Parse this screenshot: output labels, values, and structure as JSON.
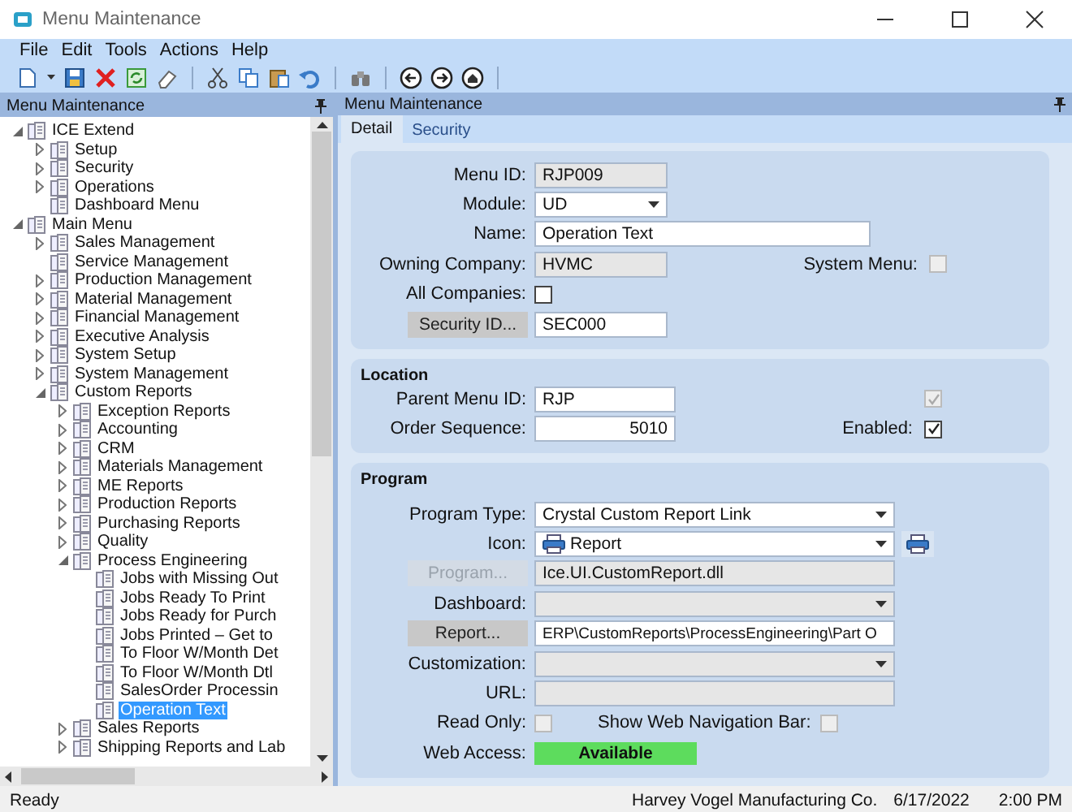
{
  "window": {
    "title": "Menu Maintenance"
  },
  "menu_bar": [
    "File",
    "Edit",
    "Tools",
    "Actions",
    "Help"
  ],
  "left_panel": {
    "title": "Menu Maintenance",
    "tree": [
      {
        "label": "ICE Extend",
        "expanded": true,
        "selected": false,
        "children": [
          {
            "label": "Setup",
            "expanded": false,
            "selected": false
          },
          {
            "label": "Security",
            "expanded": false,
            "selected": false
          },
          {
            "label": "Operations",
            "expanded": false,
            "selected": false
          },
          {
            "label": "Dashboard Menu",
            "selected": false
          }
        ]
      },
      {
        "label": "Main Menu",
        "expanded": true,
        "selected": false,
        "children": [
          {
            "label": "Sales Management",
            "expanded": false,
            "selected": false
          },
          {
            "label": "Service Management",
            "selected": false
          },
          {
            "label": "Production Management",
            "expanded": false,
            "selected": false
          },
          {
            "label": "Material Management",
            "expanded": false,
            "selected": false
          },
          {
            "label": "Financial Management",
            "expanded": false,
            "selected": false
          },
          {
            "label": "Executive Analysis",
            "expanded": false,
            "selected": false
          },
          {
            "label": "System Setup",
            "expanded": false,
            "selected": false
          },
          {
            "label": "System Management",
            "expanded": false,
            "selected": false
          },
          {
            "label": "Custom Reports",
            "expanded": true,
            "selected": false,
            "children": [
              {
                "label": "Exception Reports",
                "expanded": false,
                "selected": false
              },
              {
                "label": "Accounting",
                "expanded": false,
                "selected": false
              },
              {
                "label": "CRM",
                "expanded": false,
                "selected": false
              },
              {
                "label": "Materials Management",
                "expanded": false,
                "selected": false
              },
              {
                "label": "ME Reports",
                "expanded": false,
                "selected": false
              },
              {
                "label": "Production Reports",
                "expanded": false,
                "selected": false
              },
              {
                "label": "Purchasing Reports",
                "expanded": false,
                "selected": false
              },
              {
                "label": "Quality",
                "expanded": false,
                "selected": false
              },
              {
                "label": "Process Engineering",
                "expanded": true,
                "selected": false,
                "children": [
                  {
                    "label": "Jobs with Missing Out",
                    "selected": false
                  },
                  {
                    "label": "Jobs Ready To Print",
                    "selected": false
                  },
                  {
                    "label": "Jobs Ready for Purch",
                    "selected": false
                  },
                  {
                    "label": "Jobs Printed – Get to",
                    "selected": false
                  },
                  {
                    "label": "To Floor W/Month Det",
                    "selected": false
                  },
                  {
                    "label": "To Floor W/Month Dtl",
                    "selected": false
                  },
                  {
                    "label": "SalesOrder Processin",
                    "selected": false
                  },
                  {
                    "label": "Operation Text",
                    "selected": true
                  }
                ]
              },
              {
                "label": "Sales Reports",
                "expanded": false,
                "selected": false
              },
              {
                "label": "Shipping Reports and Lab",
                "expanded": false,
                "selected": false
              }
            ]
          }
        ]
      }
    ]
  },
  "right_panel": {
    "title": "Menu Maintenance",
    "tabs": [
      {
        "label": "Detail",
        "selected": true
      },
      {
        "label": "Security",
        "selected": false
      }
    ],
    "detail": {
      "menu_id": {
        "label": "Menu ID:",
        "value": "RJP009",
        "readonly": true
      },
      "module": {
        "label": "Module:",
        "value": "UD"
      },
      "name": {
        "label": "Name:",
        "value": "Operation Text"
      },
      "owning_company": {
        "label": "Owning Company:",
        "value": "HVMC",
        "readonly": true
      },
      "system_menu": {
        "label": "System Menu:",
        "checked": false,
        "disabled": true
      },
      "all_companies": {
        "label": "All Companies:",
        "checked": false,
        "disabled": false
      },
      "security_id": {
        "button": "Security ID...",
        "value": "SEC000"
      }
    },
    "location": {
      "title": "Location",
      "parent_menu_id": {
        "label": "Parent Menu ID:",
        "value": "RJP"
      },
      "parent_check": {
        "checked": true,
        "disabled": true
      },
      "order_sequence": {
        "label": "Order Sequence:",
        "value": "5010"
      },
      "enabled": {
        "label": "Enabled:",
        "checked": true,
        "disabled": false
      }
    },
    "program": {
      "title": "Program",
      "program_type": {
        "label": "Program Type:",
        "value": "Crystal Custom Report Link"
      },
      "icon": {
        "label": "Icon:",
        "value": "Report"
      },
      "program": {
        "button": "Program...",
        "disabled": true,
        "value": "Ice.UI.CustomReport.dll",
        "readonly": true
      },
      "dashboard": {
        "label": "Dashboard:",
        "readonly": true
      },
      "report": {
        "button": "Report...",
        "disabled": false,
        "value": "ERP\\CustomReports\\ProcessEngineering\\Part O"
      },
      "customization": {
        "label": "Customization:",
        "readonly": true
      },
      "url": {
        "label": "URL:",
        "readonly": true
      },
      "read_only": {
        "label": "Read Only:",
        "checked": false,
        "disabled": true
      },
      "show_web_navigation_bar": {
        "label": "Show Web Navigation Bar:",
        "checked": false,
        "disabled": true
      },
      "web_access": {
        "label": "Web Access:",
        "value": "Available"
      }
    }
  },
  "status_bar": {
    "message": "Ready",
    "company": "Harvey Vogel Manufacturing Co.",
    "date": "6/17/2022",
    "time": "2:00 PM"
  }
}
